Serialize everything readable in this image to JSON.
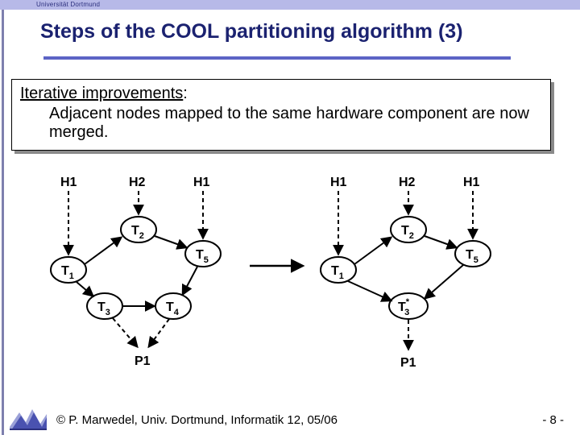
{
  "header": {
    "university": "Universität Dortmund"
  },
  "title": "Steps of the COOL partitioning algorithm (3)",
  "textbox": {
    "heading": "Iterative improvements",
    "colon": ":",
    "body": "Adjacent nodes mapped to the same hardware component are now merged."
  },
  "graph": {
    "left": {
      "hw": [
        "H1",
        "H2",
        "H1"
      ],
      "nodes": {
        "t1": "T",
        "t2": "T",
        "t3": "T",
        "t4": "T",
        "t5": "T"
      },
      "subs": {
        "t1": "1",
        "t2": "2",
        "t3": "3",
        "t4": "4",
        "t5": "5"
      },
      "proc": "P1"
    },
    "right": {
      "hw": [
        "H1",
        "H2",
        "H1"
      ],
      "nodes": {
        "t1": "T",
        "t2": "T",
        "t3star": "T",
        "t5": "T"
      },
      "subs": {
        "t1": "1",
        "t2": "2",
        "t3star": "3",
        "t5": "5"
      },
      "star": "*",
      "proc": "P1"
    }
  },
  "footer": {
    "author": "© P. Marwedel, Univ. Dortmund, Informatik 12, 05/06",
    "page": "-  8 -"
  }
}
